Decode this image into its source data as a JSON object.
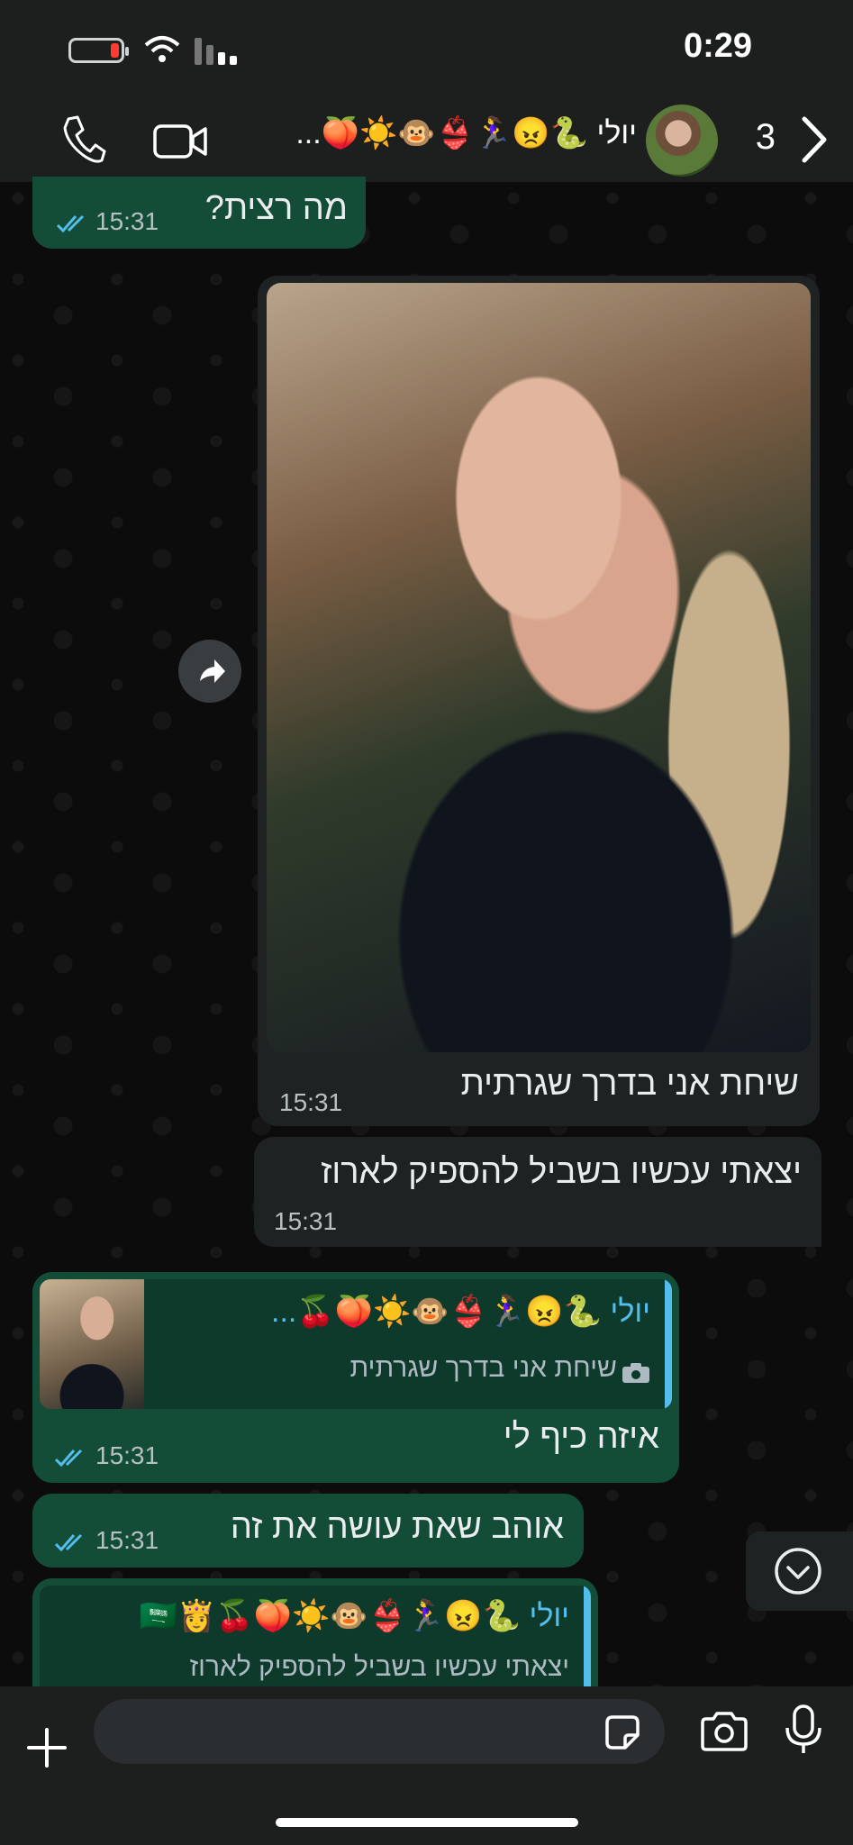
{
  "status_bar": {
    "time": "0:29",
    "battery_level": 0.1
  },
  "header": {
    "contact_name": "יולי 🐍😠🏃‍♀️👙🐵☀️🍑...",
    "unread_count": "3",
    "icons": [
      "phone-icon",
      "video-icon",
      "back-chevron-icon"
    ]
  },
  "messages": [
    {
      "type": "outgoing",
      "text": "מה רצית?",
      "time": "15:31",
      "status": "read"
    },
    {
      "type": "incoming-photo",
      "caption": "שיחת אני בדרך שגרתית",
      "time": "15:31"
    },
    {
      "type": "incoming",
      "text": "יצאתי עכשיו בשביל להספיק לארוז",
      "time": "15:31"
    },
    {
      "type": "outgoing-reply",
      "reply_name": "יולי 🐍😠🏃‍♀️👙🐵☀️🍑🍒...",
      "reply_text": "שיחת אני בדרך שגרתית",
      "text": "איזה כיף לי",
      "time": "15:31",
      "status": "read"
    },
    {
      "type": "outgoing",
      "text": "אוהב שאת עושה את זה",
      "time": "15:31",
      "status": "read"
    },
    {
      "type": "outgoing-reply",
      "reply_name": "יולי 🐍😠🏃‍♀️👙🐵☀️🍑🍒👸🇸🇦",
      "reply_text": "יצאתי עכשיו בשביל להספיק לארוז"
    }
  ],
  "colors": {
    "outgoing": "#144d37",
    "incoming": "#1f2223",
    "accent": "#53bdeb"
  }
}
